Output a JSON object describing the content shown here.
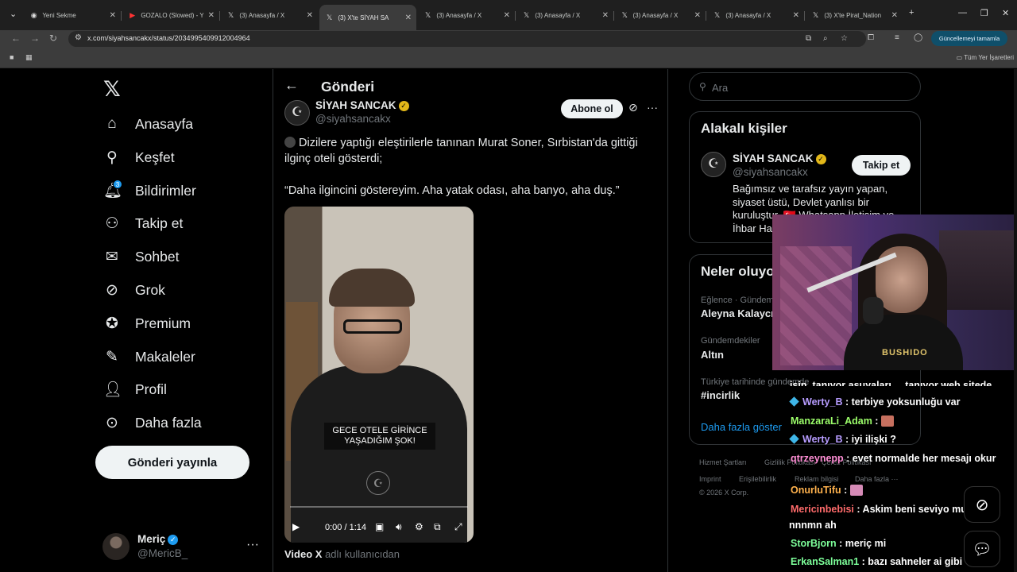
{
  "browser": {
    "tabs": [
      {
        "title": "Yeni Sekme",
        "icon": "chrome-icon"
      },
      {
        "title": "GOZALO (Slowed) - Y",
        "icon": "youtube-icon"
      },
      {
        "title": "(3) Anasayfa / X",
        "icon": "x-icon"
      },
      {
        "title": "(3) X'te SİYAH SA",
        "icon": "x-icon",
        "active": true
      },
      {
        "title": "(3) Anasayfa / X",
        "icon": "x-icon"
      },
      {
        "title": "(3) Anasayfa / X",
        "icon": "x-icon"
      },
      {
        "title": "(3) Anasayfa / X",
        "icon": "x-icon"
      },
      {
        "title": "(3) Anasayfa / X",
        "icon": "x-icon"
      },
      {
        "title": "(3) X'te Pirat_Nation",
        "icon": "x-icon"
      }
    ],
    "url": "x.com/siyahsancakx/status/2034995409912004964",
    "update_button": "Güncellemeyi tamamla",
    "bookmarks_all": "Tüm Yer İşaretleri"
  },
  "nav": {
    "items": [
      {
        "label": "Anasayfa",
        "icon": "home-icon"
      },
      {
        "label": "Keşfet",
        "icon": "search-icon"
      },
      {
        "label": "Bildirimler",
        "icon": "bell-icon",
        "badge": "3"
      },
      {
        "label": "Takip et",
        "icon": "person-add-icon"
      },
      {
        "label": "Sohbet",
        "icon": "mail-icon"
      },
      {
        "label": "Grok",
        "icon": "grok-icon"
      },
      {
        "label": "Premium",
        "icon": "premium-icon"
      },
      {
        "label": "Makaleler",
        "icon": "articles-icon"
      },
      {
        "label": "Profil",
        "icon": "profile-icon"
      },
      {
        "label": "Daha fazla",
        "icon": "more-circle-icon"
      }
    ],
    "post_button": "Gönderi yayınla",
    "account": {
      "name": "Meriç",
      "handle": "@MericB_"
    }
  },
  "post": {
    "header_title": "Gönderi",
    "author_name": "SİYAH SANCAK",
    "author_handle": "@siyahsancakx",
    "follow_label": "Abone ol",
    "text_line1": "Dizilere yaptığı eleştirilerle tanınan Murat Soner, Sırbistan'da gittiği ilginç oteli gösterdi;",
    "text_line2": "“Daha ilgincini göstereyim. Aha yatak odası, aha banyo, aha duş.”",
    "video": {
      "caption": "GECE OTELE GİRİNCE YAŞADIĞIM ŞOK!",
      "time": "0:00 / 1:14",
      "progress_fraction": 0.0
    },
    "video_source_bold": "Video X",
    "video_source_rest": " adlı kullanıcıdan"
  },
  "sidebar": {
    "search_placeholder": "Ara",
    "related_title": "Alakalı kişiler",
    "related": {
      "name": "SİYAH SANCAK",
      "handle": "@siyahsancakx",
      "follow_label": "Takip et",
      "bio": "Bağımsız ve tarafsız yayın yapan, siyaset üstü, Devlet yanlısı bir kuruluştur. 🇹🇷 Whatsapp İletişim ve İhbar Hattı"
    },
    "trends_title": "Neler oluyor",
    "trends": [
      {
        "meta": "Eğlence · Gündemde",
        "name": "Aleyna Kalaycıoğlu"
      },
      {
        "meta": "Gündemdekiler",
        "name": "Altın"
      },
      {
        "meta": "Türkiye tarihinde gündemde",
        "name": "#incirlik"
      }
    ],
    "show_more": "Daha fazla göster",
    "footer": [
      "Hizmet Şartları",
      "Gizlilik Politikası",
      "Çerez Politikası",
      "Imprint",
      "Erişilebilirlik",
      "Reklam bilgisi",
      "Daha fazla ···",
      "© 2026 X Corp."
    ]
  },
  "stream": {
    "webcam_shirt_text": "BUSHIDO",
    "chat": [
      {
        "user": "Werty_B",
        "msg": ": terbiye yoksunluğu var",
        "color": "#b79cff",
        "badge": true
      },
      {
        "user": "ManzaraLi_Adam",
        "msg": ":",
        "color": "#9dff6b",
        "emote": "emote"
      },
      {
        "user": "Werty_B",
        "msg": ": iyi ilişki ?",
        "color": "#b79cff",
        "badge": true
      },
      {
        "user": "qtrzeynepp",
        "msg": ": evet normalde her mesajı okur",
        "color": "#ff8fd6"
      },
      {
        "user": "OnurluTifu",
        "msg": ":",
        "color": "#ffb24d",
        "emote": "emote-pink"
      },
      {
        "user": "Mericinbebisi",
        "msg": ": Askim beni seviyo musunnn",
        "color": "#ff6b6b"
      },
      {
        "user": "",
        "msg": "nnnmn ah",
        "color": "#ffffff"
      },
      {
        "user": "StorBjorn",
        "msg": ": meriç mi",
        "color": "#7dff9a"
      },
      {
        "user": "ErkanSalman1",
        "msg": ": bazı sahneler ai gibi",
        "color": "#7dff9a"
      }
    ],
    "cut_text": "işin, tanıyor asuyaları ... tanıyor web sitede"
  }
}
